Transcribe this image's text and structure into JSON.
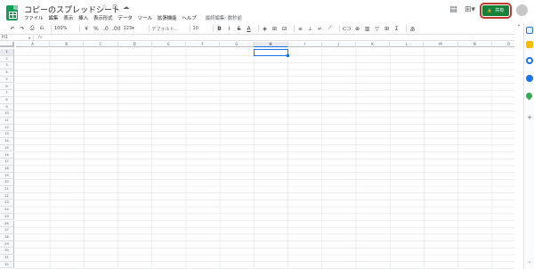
{
  "app": {
    "title": "コピーのスプレッドシート",
    "title_icons": [
      "☆",
      "⊡",
      "☁"
    ],
    "menu": [
      "ファイル",
      "編集",
      "表示",
      "挿入",
      "表示形式",
      "データ",
      "ツール",
      "拡張機能",
      "ヘルプ"
    ],
    "last_edit": "最終編集: 数秒前"
  },
  "header": {
    "comments_icon": "▤",
    "meet_icon": "⊞▾",
    "share_label": "共有",
    "share_icon": "🔒",
    "share_color": "#188038",
    "highlight_color": "#c0392b"
  },
  "toolbar": {
    "undo": "↶",
    "redo": "↷",
    "print": "⎙",
    "paint_format": "⎌",
    "zoom": "100%",
    "currency": "¥",
    "percent": "%",
    "decimal_decrease": ".0",
    "decimal_increase": ".00",
    "more_formats": "123▾",
    "font": "デフォルト...",
    "font_size": "10",
    "bold": "B",
    "italic": "I",
    "strike": "S",
    "text_color": "A",
    "fill": "◈",
    "borders": "⊞",
    "merge": "⊟",
    "halign": "≡",
    "valign": "⊥",
    "wrap": "↵",
    "rotate": "⟋",
    "link": "⊂⊃",
    "comment": "⊕",
    "chart": "▥",
    "filter": "▽",
    "filter_views": "⊞",
    "functions": "Σ",
    "input_tools": "あ",
    "collapse": "⌃"
  },
  "formula_bar": {
    "cell_ref": "H1",
    "fx": "fx",
    "value": ""
  },
  "grid": {
    "columns": [
      "A",
      "B",
      "C",
      "D",
      "E",
      "F",
      "G",
      "H",
      "I",
      "J",
      "K",
      "L",
      "M",
      "N",
      "O"
    ],
    "rows": [
      "1",
      "2",
      "3",
      "4",
      "5",
      "6",
      "7",
      "8",
      "9",
      "10",
      "11",
      "12",
      "13",
      "14",
      "15",
      "16",
      "17",
      "18",
      "19",
      "20",
      "21",
      "22",
      "23",
      "24",
      "25",
      "26",
      "27",
      "28",
      "29",
      "30",
      "31",
      "32"
    ],
    "selected_column": "H",
    "selected_row": "1",
    "accent": "#1a73e8"
  },
  "side_panel": {
    "icons": [
      "calendar-icon",
      "keep-icon",
      "tasks-icon",
      "contacts-icon",
      "maps-icon"
    ],
    "add_label": "+",
    "expand_label": "›"
  }
}
